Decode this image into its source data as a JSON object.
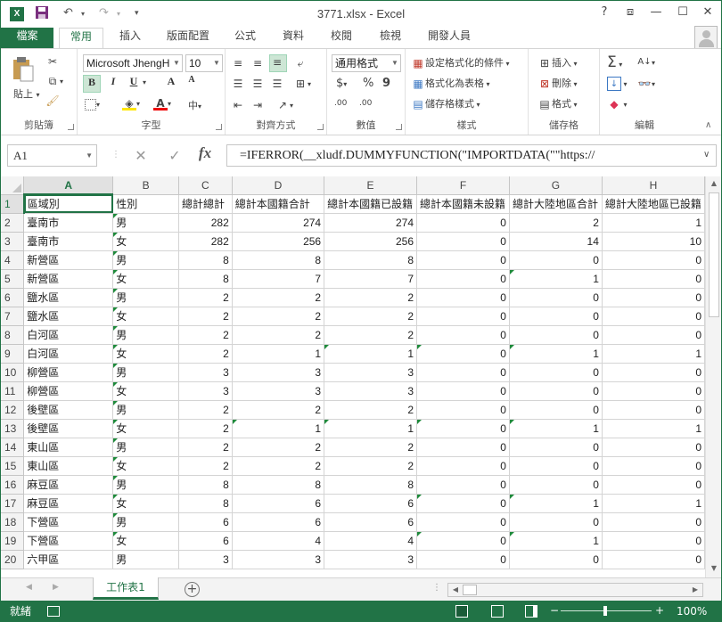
{
  "window": {
    "title": "3771.xlsx - Excel",
    "logo": "X",
    "help": "?",
    "minimize": "—",
    "restore": "☐",
    "close": "✕",
    "ribbon_display": "⧈"
  },
  "quick_access": {
    "save": "save-icon",
    "undo": "↶",
    "redo": "↷",
    "customize": "▾"
  },
  "tabs": [
    "檔案",
    "常用",
    "插入",
    "版面配置",
    "公式",
    "資料",
    "校閱",
    "檢視",
    "開發人員"
  ],
  "active_tab": "常用",
  "ribbon": {
    "clipboard": {
      "label": "剪貼簿",
      "paste": "貼上"
    },
    "font": {
      "label": "字型",
      "name": "Microsoft JhengH",
      "size": "10",
      "bold": "B",
      "italic": "I",
      "underline": "U",
      "grow": "A",
      "shrink": "A",
      "phonetic": "中"
    },
    "alignment": {
      "label": "對齊方式"
    },
    "number": {
      "label": "數值",
      "format": "通用格式",
      "currency": "$",
      "percent": "%",
      "comma": "9",
      "inc_decimal": ".00",
      "dec_decimal": ".00"
    },
    "styles": {
      "label": "樣式",
      "conditional": "設定格式化的條件",
      "as_table": "格式化為表格",
      "cell_styles": "儲存格樣式"
    },
    "cells": {
      "label": "儲存格",
      "insert": "插入",
      "delete": "刪除",
      "format": "格式"
    },
    "editing": {
      "label": "編輯",
      "sum": "Σ",
      "sort": "A",
      "find": "🔍"
    }
  },
  "formula_bar": {
    "name_box": "A1",
    "fx": "fx",
    "formula": "=IFERROR(__xludf.DUMMYFUNCTION(\"IMPORTDATA(\"\"https://"
  },
  "sheet": {
    "columns": [
      "A",
      "B",
      "C",
      "D",
      "E",
      "F",
      "G",
      "H"
    ],
    "headers": [
      "區域別",
      "性別",
      "總計總計",
      "總計本國籍合計",
      "總計本國籍已設籍",
      "總計本國籍未設籍",
      "總計大陸地區合計",
      "總計大陸地區已設籍"
    ],
    "rows": [
      [
        "臺南市",
        "男",
        "282",
        "274",
        "274",
        "0",
        "2",
        "1"
      ],
      [
        "臺南市",
        "女",
        "282",
        "256",
        "256",
        "0",
        "14",
        "10"
      ],
      [
        "新營區",
        "男",
        "8",
        "8",
        "8",
        "0",
        "0",
        "0"
      ],
      [
        "新營區",
        "女",
        "8",
        "7",
        "7",
        "0",
        "1",
        "0"
      ],
      [
        "鹽水區",
        "男",
        "2",
        "2",
        "2",
        "0",
        "0",
        "0"
      ],
      [
        "鹽水區",
        "女",
        "2",
        "2",
        "2",
        "0",
        "0",
        "0"
      ],
      [
        "白河區",
        "男",
        "2",
        "2",
        "2",
        "0",
        "0",
        "0"
      ],
      [
        "白河區",
        "女",
        "2",
        "1",
        "1",
        "0",
        "1",
        "1"
      ],
      [
        "柳營區",
        "男",
        "3",
        "3",
        "3",
        "0",
        "0",
        "0"
      ],
      [
        "柳營區",
        "女",
        "3",
        "3",
        "3",
        "0",
        "0",
        "0"
      ],
      [
        "後壁區",
        "男",
        "2",
        "2",
        "2",
        "0",
        "0",
        "0"
      ],
      [
        "後壁區",
        "女",
        "2",
        "1",
        "1",
        "0",
        "1",
        "1"
      ],
      [
        "東山區",
        "男",
        "2",
        "2",
        "2",
        "0",
        "0",
        "0"
      ],
      [
        "東山區",
        "女",
        "2",
        "2",
        "2",
        "0",
        "0",
        "0"
      ],
      [
        "麻豆區",
        "男",
        "8",
        "8",
        "8",
        "0",
        "0",
        "0"
      ],
      [
        "麻豆區",
        "女",
        "8",
        "6",
        "6",
        "0",
        "1",
        "1"
      ],
      [
        "下營區",
        "男",
        "6",
        "6",
        "6",
        "0",
        "0",
        "0"
      ],
      [
        "下營區",
        "女",
        "6",
        "4",
        "4",
        "0",
        "1",
        "0"
      ],
      [
        "六甲區",
        "男",
        "3",
        "3",
        "3",
        "0",
        "0",
        "0"
      ]
    ]
  },
  "sheet_tabs": [
    "工作表1"
  ],
  "add_sheet": "+",
  "status": {
    "ready": "就緒",
    "zoom": "100%",
    "zoom_out": "−",
    "zoom_in": "+"
  }
}
